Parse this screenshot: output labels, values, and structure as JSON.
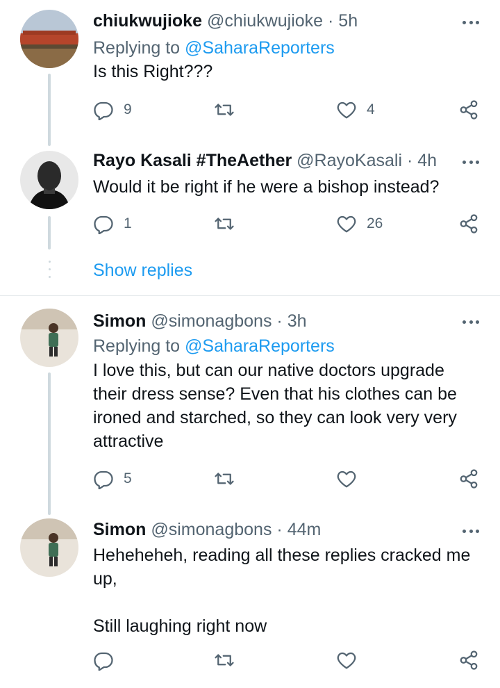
{
  "tweets": [
    {
      "name": "chiukwujioke",
      "handle": "@chiukwujioke",
      "sep": "·",
      "time": "5h",
      "replying_prefix": "Replying to ",
      "replying_to": "@SaharaReporters",
      "text": "Is this Right???",
      "replies": "9",
      "retweets": "",
      "likes": "4"
    },
    {
      "name": "Rayo Kasali #TheAether",
      "handle": "@RayoKasali",
      "sep": "·",
      "time": "4h",
      "text": "Would it be right if he were a bishop instead?",
      "replies": "1",
      "retweets": "",
      "likes": "26"
    },
    {
      "name": "Simon",
      "handle": "@simonagbons",
      "sep": "·",
      "time": "3h",
      "replying_prefix": "Replying to ",
      "replying_to": "@SaharaReporters",
      "text": "I love this, but can our native doctors upgrade their dress sense? Even that his clothes can be ironed and starched, so they can look very very attractive",
      "replies": "5",
      "retweets": "",
      "likes": ""
    },
    {
      "name": "Simon",
      "handle": "@simonagbons",
      "sep": "·",
      "time": "44m",
      "text": "Heheheheh, reading all these replies cracked me up,\n\nStill laughing right now",
      "replies": "",
      "retweets": "",
      "likes": ""
    }
  ],
  "show_replies_label": "Show replies",
  "icons": [
    "reply-icon",
    "retweet-icon",
    "like-icon",
    "share-icon",
    "more-icon"
  ],
  "colors": {
    "link": "#1d9bf0",
    "muted": "#536471",
    "text": "#0f1419",
    "thread": "#cfd9de"
  }
}
